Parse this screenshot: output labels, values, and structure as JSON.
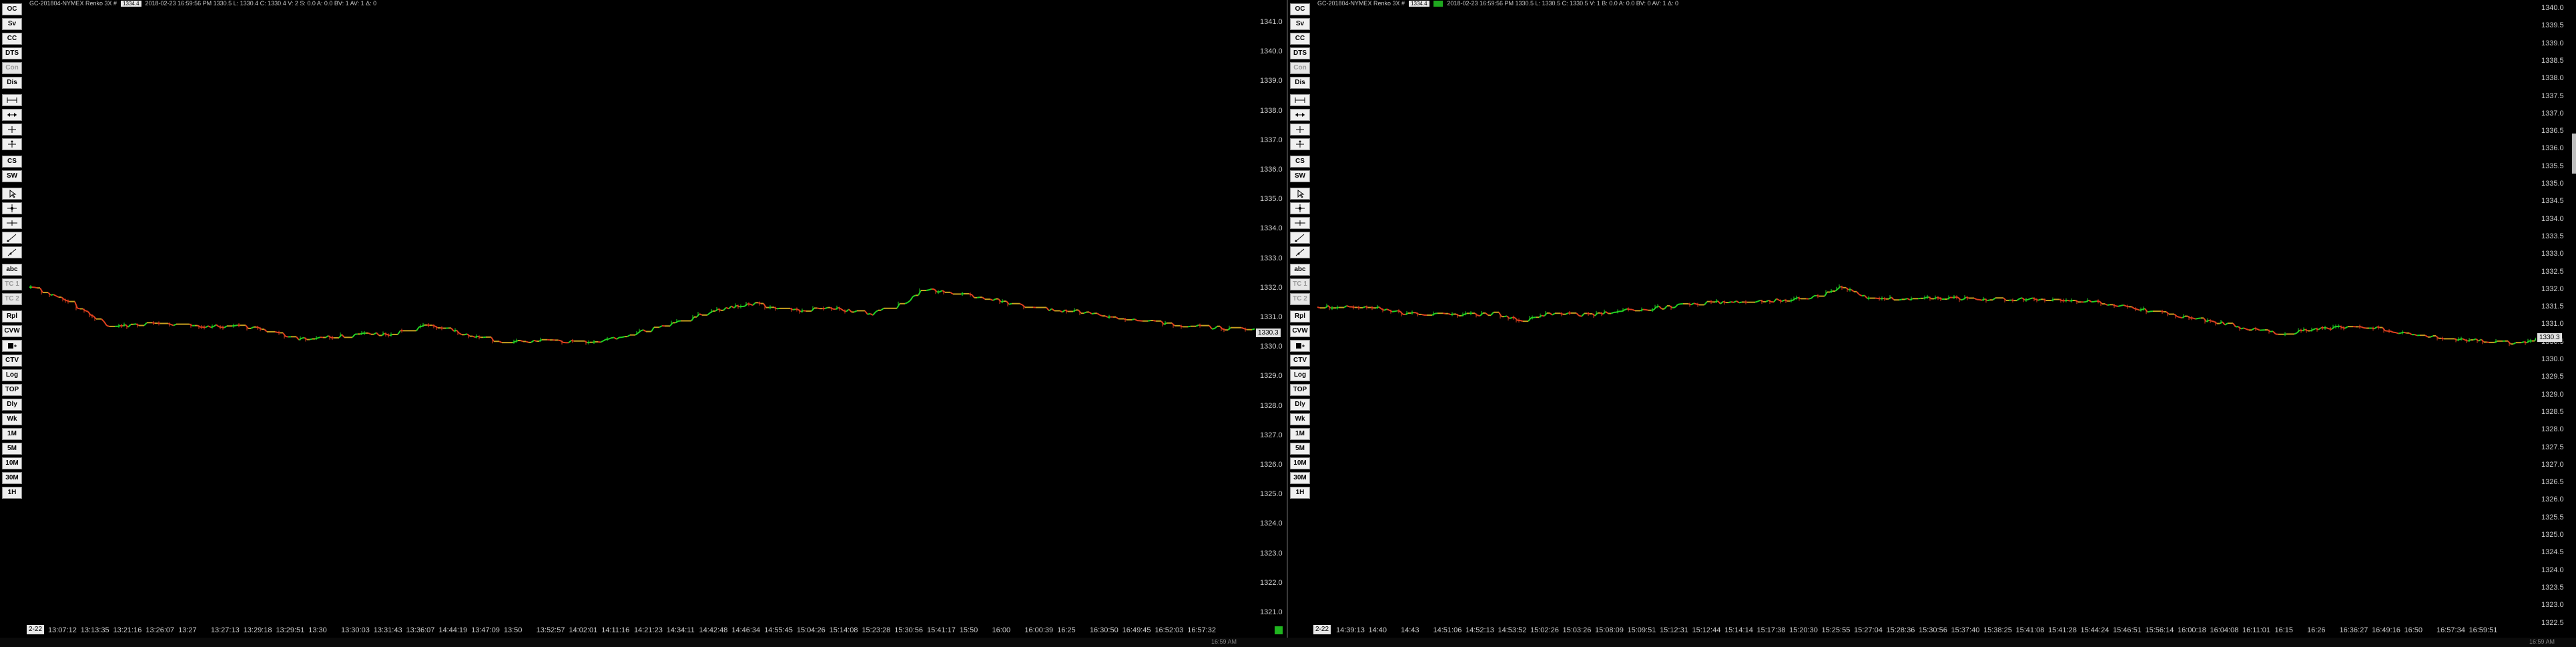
{
  "colors": {
    "up": "#22d422",
    "down": "#e0401e",
    "neutral": "#c8a020",
    "background": "#000000"
  },
  "left_chart": {
    "header_text": "GC-201804-NYMEX  Renko 3X  #",
    "header_boxes": [
      "1334.4",
      "",
      "",
      ""
    ],
    "header_values": "2018-02-23  16:59:56 PM  1330.5  L: 1330.4  C: 1330.4  V: 2 S: 0.0 A: 0.0 BV: 1 AV: 1 Δ: 0",
    "start_date": "2-22",
    "current_price": "1330.3",
    "price_ticks": [
      "1341.0",
      "1340.0",
      "1339.0",
      "1338.0",
      "1337.0",
      "1336.0",
      "1335.0",
      "1334.0",
      "1333.0",
      "1332.0",
      "1331.0",
      "1330.0",
      "1329.0",
      "1328.0",
      "1327.0",
      "1326.0",
      "1325.0",
      "1324.0",
      "1323.0",
      "1322.0",
      "1321.0"
    ],
    "time_ticks": [
      "13:07:12",
      "13:13:35",
      "13:21:16",
      "13:26:07",
      "13:27",
      "13:27:13",
      "13:29:18",
      "13:29:51",
      "13:30",
      "13:30:03",
      "13:31:43",
      "13:36:07",
      "14:44:19",
      "13:47:09",
      "13:50",
      "13:52:57",
      "14:02:01",
      "14:11:16",
      "14:21:23",
      "14:34:11",
      "14:42:48",
      "14:46:34",
      "14:55:45",
      "15:04:26",
      "15:14:08",
      "15:23:28",
      "15:30:56",
      "15:41:17",
      "15:50",
      "16:00",
      "16:00:39",
      "16:25",
      "16:30:50",
      "16:49:45",
      "16:52:03",
      "16:57:32"
    ]
  },
  "right_chart": {
    "header_text": "GC-201804-NYMEX  Renko 3X  #",
    "header_boxes": [
      "1334.4",
      "",
      "",
      ""
    ],
    "header_values": "2018-02-23  16:59:56 PM  1330.5  L: 1330.5  C: 1330.5  V: 1 B: 0.0 A: 0.0 BV: 0 AV: 1 Δ: 0",
    "start_date": "2-22",
    "current_price": "1330.3",
    "price_ticks": [
      "1340.0",
      "1339.5",
      "1339.0",
      "1338.5",
      "1338.0",
      "1337.5",
      "1337.0",
      "1336.5",
      "1336.0",
      "1335.5",
      "1335.0",
      "1334.5",
      "1334.0",
      "1333.5",
      "1333.0",
      "1332.5",
      "1332.0",
      "1331.5",
      "1331.0",
      "1330.5",
      "1330.0",
      "1329.5",
      "1329.0",
      "1328.5",
      "1328.0",
      "1327.5",
      "1327.0",
      "1326.5",
      "1326.0",
      "1325.5",
      "1325.0",
      "1324.5",
      "1324.0",
      "1323.5",
      "1323.0",
      "1322.5"
    ],
    "time_ticks": [
      "14:39:13",
      "14:40",
      "14:43",
      "14:51:06",
      "14:52:13",
      "14:53:52",
      "15:02:26",
      "15:03:26",
      "15:08:09",
      "15:09:51",
      "15:12:31",
      "15:12:44",
      "15:14:14",
      "15:17:38",
      "15:20:30",
      "15:25:55",
      "15:27:04",
      "15:28:36",
      "15:30:56",
      "15:37:40",
      "15:38:25",
      "15:41:08",
      "15:41:28",
      "15:44:24",
      "15:46:51",
      "15:56:14",
      "16:00:18",
      "16:04:08",
      "16:11:01",
      "16:15",
      "16:26",
      "16:36:27",
      "16:49:16",
      "16:50",
      "16:57:34",
      "16:59:51"
    ]
  },
  "toolbar": {
    "buttons": [
      "OC",
      "Sv",
      "CC",
      "DTS",
      "Con",
      "Dis",
      "",
      "",
      "",
      "",
      "CS",
      "SW",
      "",
      "",
      "",
      "",
      "",
      "abc",
      "TC 1",
      "TC 2",
      "Rpl",
      "CVW",
      "",
      "CTV",
      "Log",
      "TOP",
      "Dly",
      "Wk",
      "1M",
      "5M",
      "10M",
      "30M",
      "1H"
    ],
    "icons": [
      "",
      "",
      "",
      "",
      "",
      "",
      "measure-icon",
      "range-icon",
      "crosshair-icon",
      "move-icon",
      "",
      "",
      "pointer-icon",
      "crosshair-cursor-icon",
      "horizontal-line-icon",
      "trendline-icon",
      "ray-icon",
      "",
      "",
      "",
      "",
      "",
      "grid-tools-icon",
      "",
      "",
      "",
      "",
      "",
      "",
      "",
      "",
      "",
      ""
    ],
    "disabled": [
      false,
      false,
      false,
      false,
      true,
      false,
      false,
      false,
      false,
      false,
      false,
      false,
      false,
      false,
      false,
      false,
      false,
      false,
      true,
      true,
      false,
      false,
      false,
      false,
      false,
      false,
      false,
      false,
      false,
      false,
      false,
      false,
      false
    ]
  },
  "bottom": {
    "left_clock": "16:59 AM",
    "right_clock": "16:59 AM"
  }
}
